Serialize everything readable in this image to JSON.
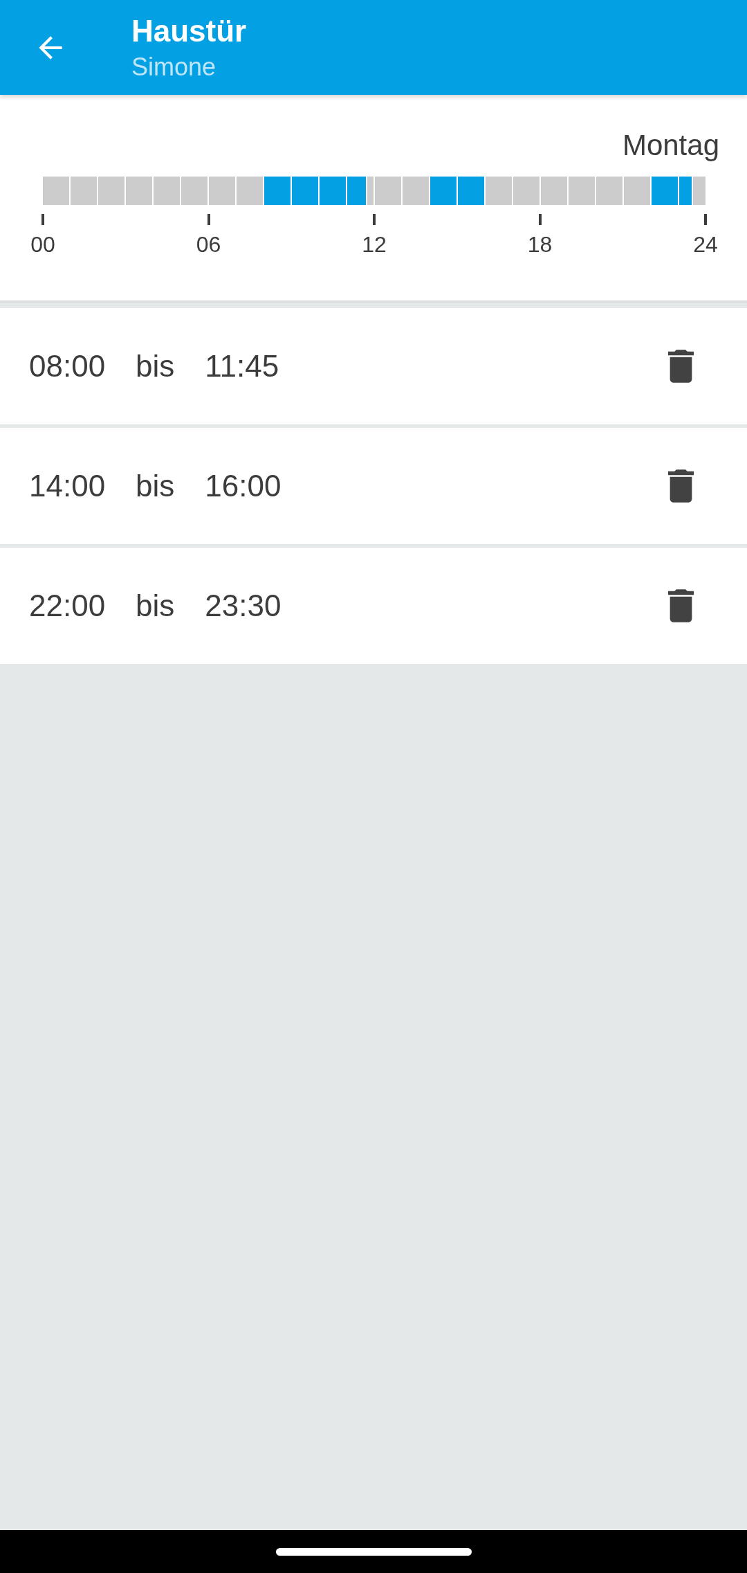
{
  "app_bar": {
    "title": "Haustür",
    "subtitle": "Simone"
  },
  "timeline": {
    "day": "Montag",
    "hours": [
      {
        "kind": "empty"
      },
      {
        "kind": "empty"
      },
      {
        "kind": "empty"
      },
      {
        "kind": "empty"
      },
      {
        "kind": "empty"
      },
      {
        "kind": "empty"
      },
      {
        "kind": "empty"
      },
      {
        "kind": "empty"
      },
      {
        "kind": "full"
      },
      {
        "kind": "full"
      },
      {
        "kind": "full"
      },
      {
        "kind": "threequarter"
      },
      {
        "kind": "empty"
      },
      {
        "kind": "empty"
      },
      {
        "kind": "full"
      },
      {
        "kind": "full"
      },
      {
        "kind": "empty"
      },
      {
        "kind": "empty"
      },
      {
        "kind": "empty"
      },
      {
        "kind": "empty"
      },
      {
        "kind": "empty"
      },
      {
        "kind": "empty"
      },
      {
        "kind": "full"
      },
      {
        "kind": "half"
      }
    ],
    "ticks": [
      "00",
      "06",
      "12",
      "18",
      "24"
    ]
  },
  "intervals": [
    {
      "from": "08:00",
      "separator": "bis",
      "to": "11:45"
    },
    {
      "from": "14:00",
      "separator": "bis",
      "to": "16:00"
    },
    {
      "from": "22:00",
      "separator": "bis",
      "to": "23:30"
    }
  ]
}
